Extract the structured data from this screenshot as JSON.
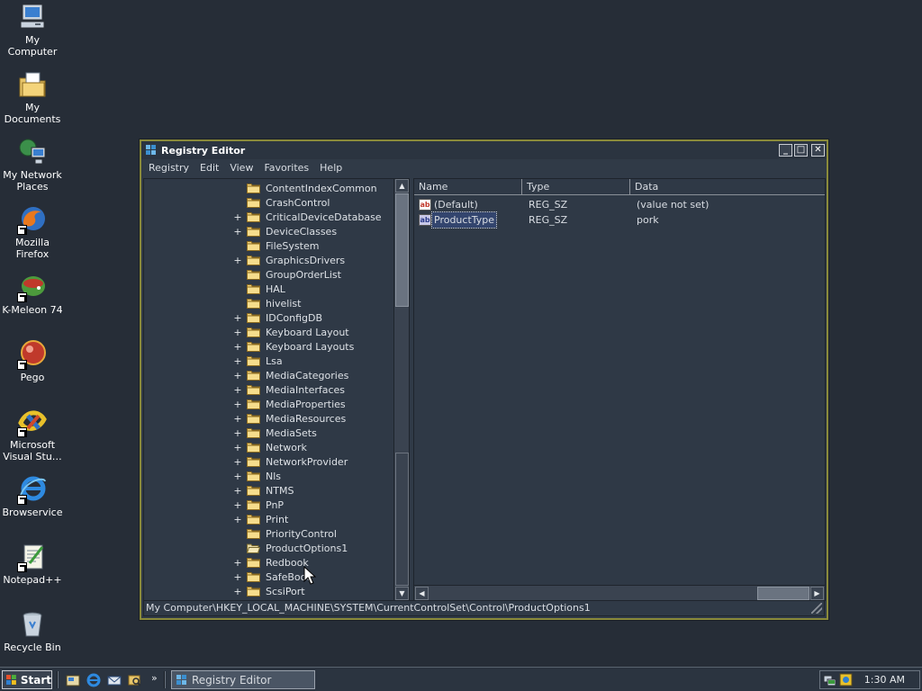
{
  "desktop": {
    "icons": [
      {
        "label": "My Computer",
        "icon": "my-computer-icon"
      },
      {
        "label": "My Documents",
        "icon": "my-documents-icon"
      },
      {
        "label": "My Network Places",
        "icon": "network-places-icon"
      },
      {
        "label": "Mozilla Firefox",
        "icon": "firefox-icon"
      },
      {
        "label": "K-Meleon 74",
        "icon": "k-meleon-icon"
      },
      {
        "label": "Pego",
        "icon": "pego-icon"
      },
      {
        "label": "Microsoft Visual Stu…",
        "icon": "visual-studio-icon"
      },
      {
        "label": "Browservice",
        "icon": "internet-explorer-icon"
      },
      {
        "label": "Notepad++",
        "icon": "notepad-plus-plus-icon"
      },
      {
        "label": "Recycle Bin",
        "icon": "recycle-bin-icon"
      }
    ]
  },
  "window": {
    "title": "Registry Editor",
    "controls": {
      "minimize": "_",
      "maximize": "□",
      "close": "✕"
    },
    "menu": [
      "Registry",
      "Edit",
      "View",
      "Favorites",
      "Help"
    ],
    "tree": {
      "items": [
        {
          "label": "ContentIndexCommon",
          "expandable": false
        },
        {
          "label": "CrashControl",
          "expandable": false
        },
        {
          "label": "CriticalDeviceDatabase",
          "expandable": true
        },
        {
          "label": "DeviceClasses",
          "expandable": true
        },
        {
          "label": "FileSystem",
          "expandable": false
        },
        {
          "label": "GraphicsDrivers",
          "expandable": true
        },
        {
          "label": "GroupOrderList",
          "expandable": false
        },
        {
          "label": "HAL",
          "expandable": false
        },
        {
          "label": "hivelist",
          "expandable": false
        },
        {
          "label": "IDConfigDB",
          "expandable": true
        },
        {
          "label": "Keyboard Layout",
          "expandable": true
        },
        {
          "label": "Keyboard Layouts",
          "expandable": true
        },
        {
          "label": "Lsa",
          "expandable": true
        },
        {
          "label": "MediaCategories",
          "expandable": true
        },
        {
          "label": "MediaInterfaces",
          "expandable": true
        },
        {
          "label": "MediaProperties",
          "expandable": true
        },
        {
          "label": "MediaResources",
          "expandable": true
        },
        {
          "label": "MediaSets",
          "expandable": true
        },
        {
          "label": "Network",
          "expandable": true
        },
        {
          "label": "NetworkProvider",
          "expandable": true
        },
        {
          "label": "Nls",
          "expandable": true
        },
        {
          "label": "NTMS",
          "expandable": true
        },
        {
          "label": "PnP",
          "expandable": true
        },
        {
          "label": "Print",
          "expandable": true
        },
        {
          "label": "PriorityControl",
          "expandable": false
        },
        {
          "label": "ProductOptions1",
          "expandable": false,
          "open": true
        },
        {
          "label": "Redbook",
          "expandable": true
        },
        {
          "label": "SafeBoot",
          "expandable": true
        },
        {
          "label": "ScsiPort",
          "expandable": true
        }
      ]
    },
    "list": {
      "columns": [
        "Name",
        "Type",
        "Data"
      ],
      "rows": [
        {
          "name": "(Default)",
          "type": "REG_SZ",
          "data": "(value not set)",
          "icon": "string-value-icon"
        },
        {
          "name": "ProductType",
          "type": "REG_SZ",
          "data": "pork",
          "icon": "string-value-icon",
          "selected": true
        }
      ]
    },
    "status_path": "My Computer\\HKEY_LOCAL_MACHINE\\SYSTEM\\CurrentControlSet\\Control\\ProductOptions1"
  },
  "taskbar": {
    "start_label": "Start",
    "quicklaunch_overflow": "»",
    "active_task": "Registry Editor",
    "clock": "1:30 AM"
  },
  "colors": {
    "desktop": "#262d37",
    "window_border": "#8a8a3a",
    "selection": "#33456e"
  }
}
